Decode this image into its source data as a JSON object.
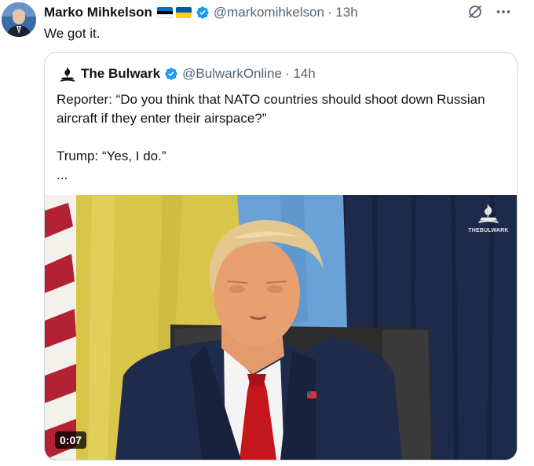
{
  "tweet": {
    "author_name": "Marko Mihkelson",
    "handle": "@markomihkelson",
    "time": "· 13h",
    "text": "We got it.",
    "flags": [
      {
        "icon": "estonia-flag-icon",
        "colors": [
          "#0072ce",
          "#000000",
          "#ffffff"
        ]
      },
      {
        "icon": "ukraine-flag-icon",
        "colors": [
          "#0057b7",
          "#ffd700"
        ]
      }
    ],
    "verified_color": "#1d9bf0"
  },
  "quote": {
    "author_name": "The Bulwark",
    "handle": "@BulwarkOnline",
    "time": "· 14h",
    "text": "Reporter: “Do you think that NATO countries should shoot down Russian aircraft if they enter their airspace?”\n\nTrump: “Yes, I do.”\n...",
    "video": {
      "duration": "0:07",
      "watermark": "THEBULWARK"
    }
  }
}
